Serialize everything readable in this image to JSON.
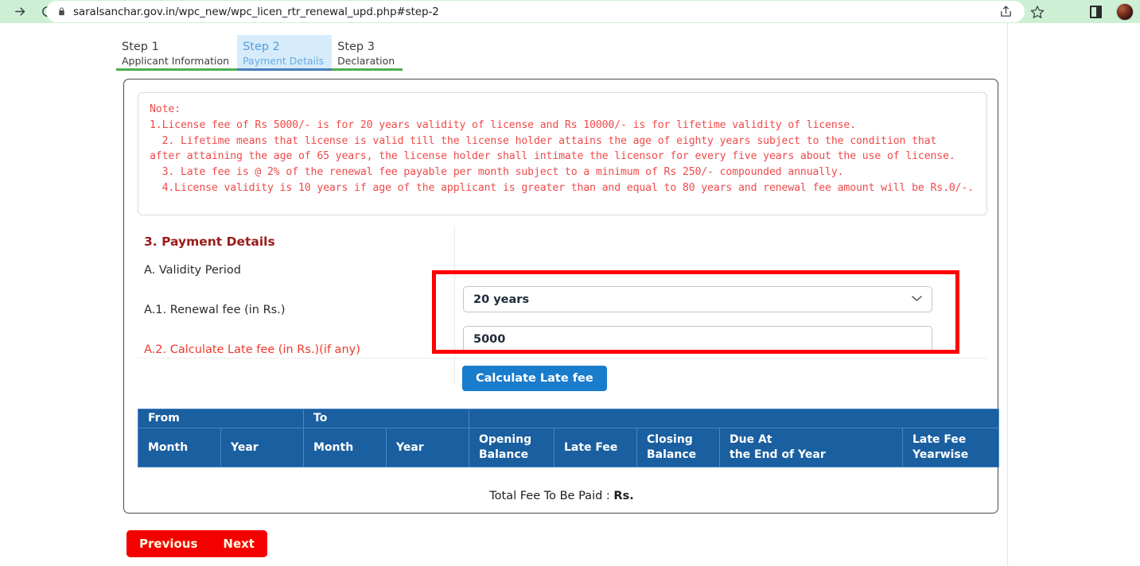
{
  "browser": {
    "url": "saralsanchar.gov.in/wpc_new/wpc_licen_rtr_renewal_upd.php#step-2",
    "icons": {
      "forward": "forward-arrow-icon",
      "reload": "reload-icon",
      "lock": "lock-icon",
      "share": "share-icon",
      "bookmark": "star-icon",
      "sidebar": "sidebar-panel-icon",
      "profile": "profile-avatar"
    }
  },
  "tabs": [
    {
      "title": "Step 1",
      "sub": "Applicant Information",
      "active": false
    },
    {
      "title": "Step 2",
      "sub": "Payment Details",
      "active": true
    },
    {
      "title": "Step 3",
      "sub": "Declaration",
      "active": false
    }
  ],
  "note": {
    "heading": "Note:",
    "lines": [
      "1.License fee of Rs 5000/- is for 20 years validity of license and Rs 10000/- is for lifetime validity of license.",
      "  2. Lifetime means that license is valid till the license holder attains the age of eighty years subject to the condition that",
      "after attaining the age of 65 years, the license holder shall intimate the licensor for every five years about the use of license.",
      "  3. Late fee is @ 2% of the renewal fee payable per month subject to a minimum of Rs 250/- compounded annually.",
      "  4.License validity is 10 years if age of the applicant is greater than and equal to 80 years and renewal fee amount will be Rs.0/-."
    ]
  },
  "section": {
    "title": "3. Payment Details",
    "validity_label": "A. Validity Period",
    "validity_value": "20 years",
    "renewal_label": "A.1. Renewal fee (in Rs.)",
    "renewal_value": "5000",
    "latefee_label": "A.2. Calculate Late fee (in Rs.)(if any)",
    "calculate_button": "Calculate Late fee"
  },
  "table": {
    "group_headers": [
      "From",
      "To",
      ""
    ],
    "columns": [
      "Month",
      "Year",
      "Month",
      "Year",
      "Opening\nBalance",
      "Late Fee",
      "Closing\nBalance",
      "Due At\nthe End of Year",
      "Late Fee\nYearwise"
    ],
    "rows": []
  },
  "total": {
    "label": "Total Fee To Be Paid : ",
    "value": "Rs."
  },
  "footer": {
    "previous": "Previous",
    "next": "Next"
  },
  "colors": {
    "table_header": "#1a5fa0",
    "note_text": "#f04a4a",
    "section_title": "#9c1b1b",
    "calc_button": "#1a7ccc",
    "footer_button": "#f50000",
    "highlight": "#ff0000",
    "active_tab_bg": "#d6ecfb",
    "tab_rule_green": "#4caf50",
    "tab_rule_blue": "#4a7ebb",
    "browser_bar": "#cdf0d4"
  }
}
